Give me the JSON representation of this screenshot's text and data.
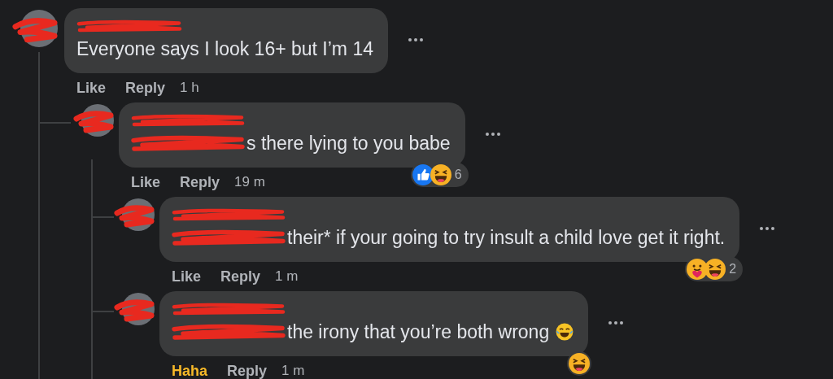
{
  "comments": [
    {
      "text": "Everyone says I look 16+ but I’m 14",
      "name_redacted": true,
      "react_label": "Like",
      "reacted": false,
      "reply_label": "Reply",
      "time": "1 h",
      "children": [
        {
          "text": "s there lying to you babe",
          "name_redacted": true,
          "text_redacted": true,
          "react_label": "Like",
          "reacted": false,
          "reply_label": "Reply",
          "time": "19 m",
          "reactions": [
            {
              "kind": "like"
            },
            {
              "kind": "haha"
            }
          ],
          "reaction_count": "6",
          "children": [
            {
              "text": "their* if your going to try insult a child love get it right.",
              "name_redacted": true,
              "text_redacted": true,
              "react_label": "Like",
              "reacted": false,
              "reply_label": "Reply",
              "time": "1 m",
              "reactions": [
                {
                  "kind": "care"
                },
                {
                  "kind": "haha"
                }
              ],
              "reaction_count": "2"
            },
            {
              "text": "the irony that you’re both wrong",
              "name_redacted": true,
              "text_redacted": true,
              "ends_with_emoji": true,
              "react_label": "Haha",
              "reacted": true,
              "reply_label": "Reply",
              "time": "1 m",
              "reactions": [
                {
                  "kind": "haha"
                }
              ]
            }
          ]
        }
      ]
    }
  ]
}
